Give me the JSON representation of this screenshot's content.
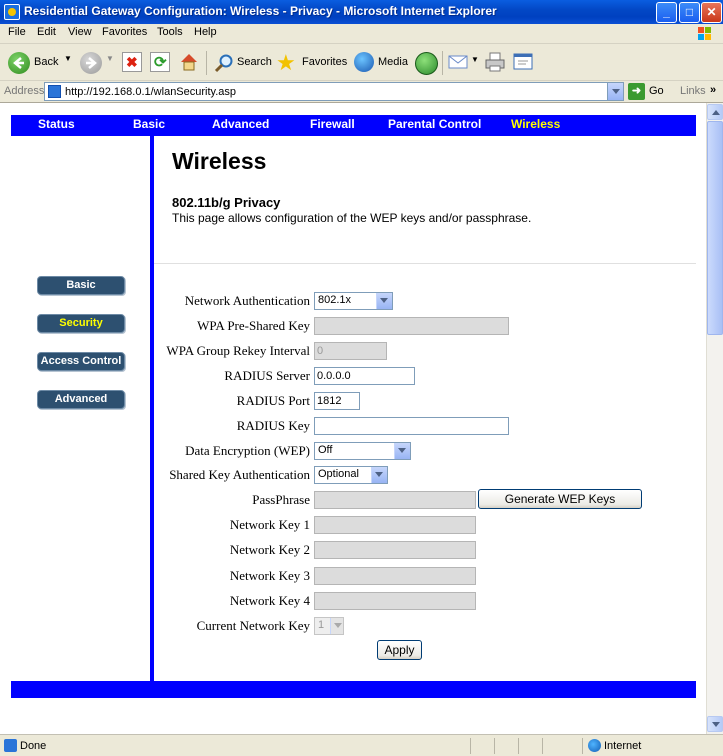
{
  "window": {
    "title": "Residential Gateway Configuration: Wireless - Privacy - Microsoft Internet Explorer",
    "controls": {
      "minimize": "_",
      "maximize": "□",
      "close": "✕"
    }
  },
  "menu": [
    "File",
    "Edit",
    "View",
    "Favorites",
    "Tools",
    "Help"
  ],
  "toolbar": {
    "back": "Back",
    "search": "Search",
    "favorites": "Favorites",
    "media": "Media"
  },
  "address": {
    "label": "Address",
    "url": "http://192.168.0.1/wlanSecurity.asp",
    "go": "Go",
    "links": "Links"
  },
  "nav": {
    "items": [
      "Status",
      "Basic",
      "Advanced",
      "Firewall",
      "Parental Control",
      "Wireless"
    ],
    "active": "Wireless"
  },
  "sidebar": {
    "items": [
      "Basic",
      "Security",
      "Access Control",
      "Advanced"
    ],
    "active": "Security"
  },
  "page": {
    "heading": "Wireless",
    "subheading": "802.11b/g Privacy",
    "description": "This page allows configuration of the WEP keys and/or passphrase."
  },
  "form": {
    "network_authentication": {
      "label": "Network Authentication",
      "value": "802.1x"
    },
    "wpa_psk": {
      "label": "WPA Pre-Shared Key",
      "value": ""
    },
    "wpa_group_rekey": {
      "label": "WPA Group Rekey Interval",
      "value": "0"
    },
    "radius_server": {
      "label": "RADIUS Server",
      "value": "0.0.0.0"
    },
    "radius_port": {
      "label": "RADIUS Port",
      "value": "1812"
    },
    "radius_key": {
      "label": "RADIUS Key",
      "value": ""
    },
    "data_encryption": {
      "label": "Data Encryption (WEP)",
      "value": "Off"
    },
    "shared_key_auth": {
      "label": "Shared Key Authentication",
      "value": "Optional"
    },
    "passphrase": {
      "label": "PassPhrase",
      "value": ""
    },
    "generate_wep_keys": "Generate WEP Keys",
    "network_key_1": {
      "label": "Network Key 1",
      "value": ""
    },
    "network_key_2": {
      "label": "Network Key 2",
      "value": ""
    },
    "network_key_3": {
      "label": "Network Key 3",
      "value": ""
    },
    "network_key_4": {
      "label": "Network Key 4",
      "value": ""
    },
    "current_network_key": {
      "label": "Current Network Key",
      "value": "1"
    },
    "apply": "Apply"
  },
  "status": {
    "text": "Done",
    "zone": "Internet"
  }
}
